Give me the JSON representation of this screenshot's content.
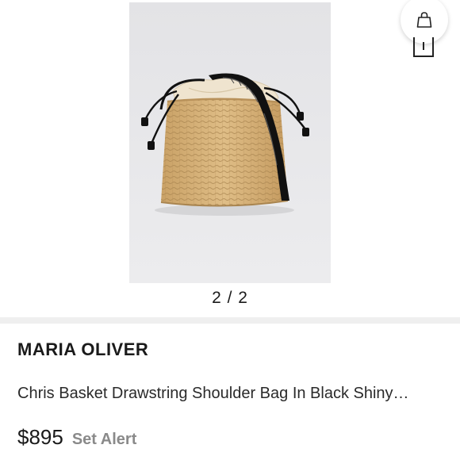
{
  "gallery": {
    "pager": "2 / 2"
  },
  "icons": {
    "bag": "shopping-bag-icon",
    "share": "share-icon"
  },
  "product": {
    "brand": "MARIA OLIVER",
    "title": "Chris Basket Drawstring Shoulder Bag In Black Shiny…",
    "price": "$895",
    "alert_label": "Set Alert"
  },
  "colors": {
    "photo_background": "#e7e7e9",
    "wicker": "#d8b47a",
    "strap": "#111111",
    "liner": "#efe4cf"
  }
}
